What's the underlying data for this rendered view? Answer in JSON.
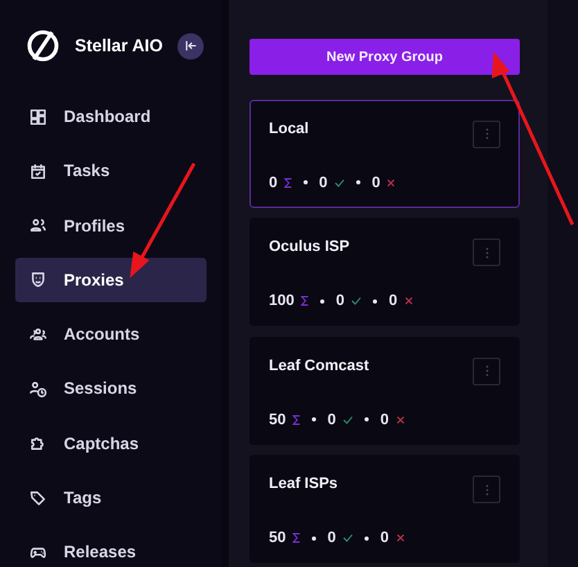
{
  "brand": {
    "name": "Stellar AIO"
  },
  "sidebar": {
    "items": [
      {
        "label": "Dashboard",
        "selected": false
      },
      {
        "label": "Tasks",
        "selected": false
      },
      {
        "label": "Profiles",
        "selected": false
      },
      {
        "label": "Proxies",
        "selected": true
      },
      {
        "label": "Accounts",
        "selected": false
      },
      {
        "label": "Sessions",
        "selected": false
      },
      {
        "label": "Captchas",
        "selected": false
      },
      {
        "label": "Tags",
        "selected": false
      },
      {
        "label": "Releases",
        "selected": false
      }
    ]
  },
  "new_button": "New Proxy Group",
  "groups": [
    {
      "name": "Local",
      "selected": true,
      "total": "0",
      "working": "0",
      "failed": "0"
    },
    {
      "name": "Oculus ISP",
      "selected": false,
      "total": "100",
      "working": "0",
      "failed": "0"
    },
    {
      "name": "Leaf Comcast",
      "selected": false,
      "total": "50",
      "working": "0",
      "failed": "0"
    },
    {
      "name": "Leaf ISPs",
      "selected": false,
      "total": "50",
      "working": "0",
      "failed": "0"
    }
  ]
}
